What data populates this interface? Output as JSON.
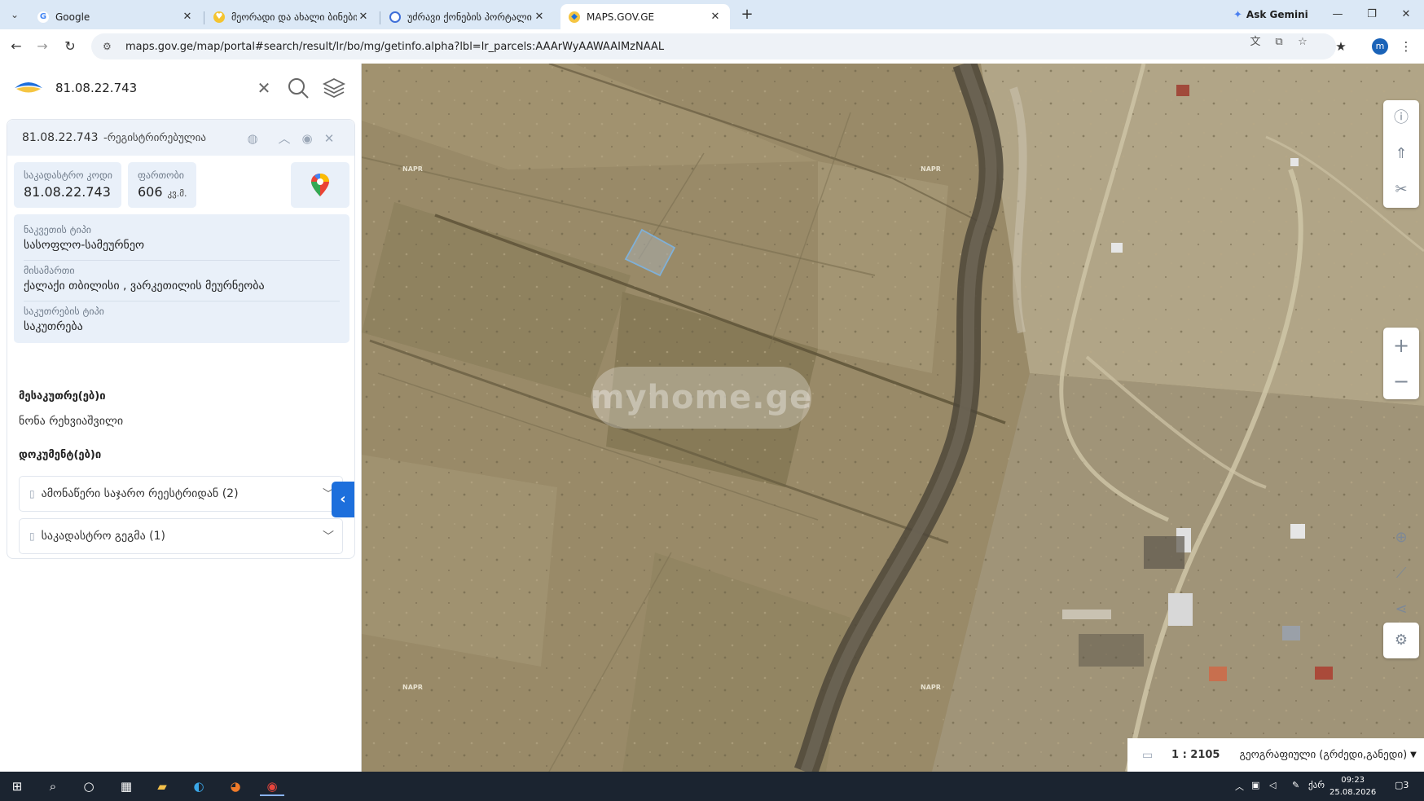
{
  "browser": {
    "tabs": [
      {
        "label": "Google",
        "close": "✕"
      },
      {
        "label": "მეორადი და ახალი ბინები",
        "close": "✕"
      },
      {
        "label": "უძრავი ქონების პორტალი",
        "close": "✕"
      },
      {
        "label": "MAPS.GOV.GE",
        "close": "✕"
      }
    ],
    "gemini_label": "Ask Gemini",
    "url": "maps.gov.ge/map/portal#search/result/lr/bo/mg/getinfo.alpha?lbl=lr_parcels:AAArWyAAWAAIMzNAAL",
    "profile_initial": "m"
  },
  "search": {
    "value": "81.08.22.743"
  },
  "parcel": {
    "code": "81.08.22.743",
    "status": "-რეგისტრირებულია",
    "cadastral_label": "საკადასტრო კოდი",
    "cadastral_value": "81.08.22.743",
    "area_label": "ფართობი",
    "area_value": "606",
    "area_unit": "კვ.მ.",
    "land_type_label": "ნაკვეთის ტიპი",
    "land_type_value": "სასოფლო-სამეურნეო",
    "address_label": "მისამართი",
    "address_value": "ქალაქი თბილისი , ვარკეთილის მეურნეობა",
    "ownership_label": "საკუთრების ტიპი",
    "ownership_value": "საკუთრება",
    "owners_title": "მესაკუთრე(ებ)ი",
    "owner_name": "ნონა რეხვიაშვილი",
    "documents_title": "დოკუმენტ(ებ)ი",
    "documents": [
      {
        "label": "ამონაწერი საჯარო რეესტრიდან (2)"
      },
      {
        "label": "საკადასტრო გეგმა (1)"
      }
    ]
  },
  "map": {
    "napr": [
      "NAPR",
      "NAPR",
      "NAPR",
      "NAPR"
    ],
    "watermark": "myhome.ge",
    "scale": "1 : 2105",
    "projection": "გეოგრაფიული (გრძედი,განედი)"
  },
  "taskbar": {
    "lang": "ქარ",
    "time": "09:23",
    "date": "25.08.2026",
    "notifications": "3"
  },
  "colors": {
    "accent": "#1d6fdc",
    "panel_tile": "#e9f0f9",
    "parcel_outline": "#7fb0d8"
  }
}
